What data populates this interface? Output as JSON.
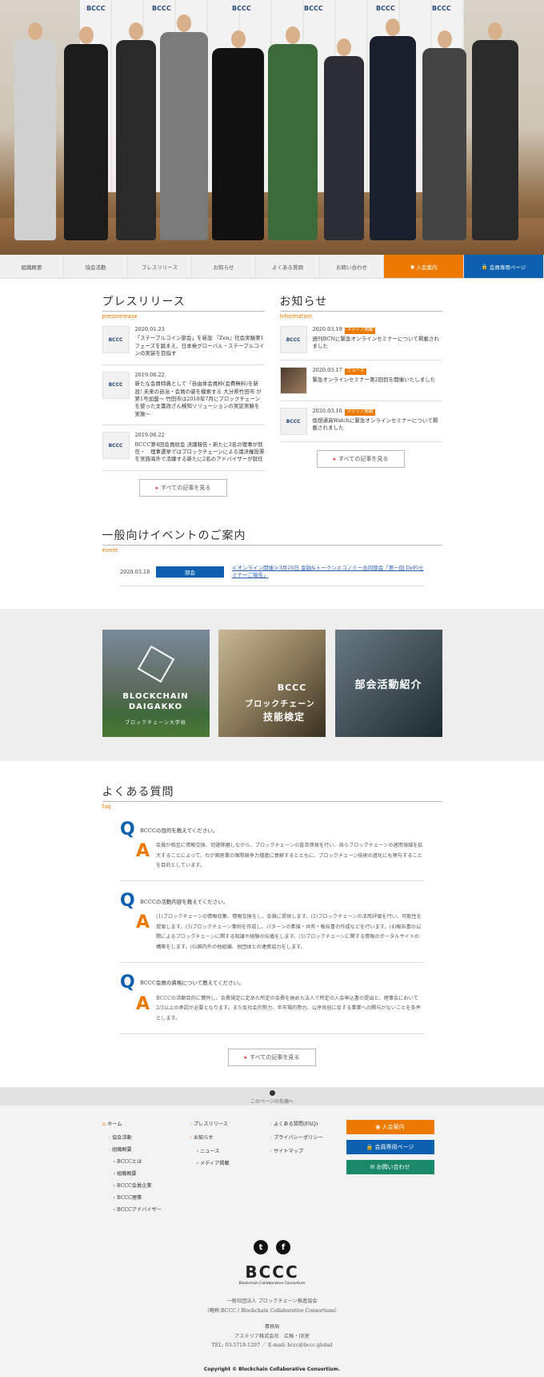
{
  "colors": {
    "accent_orange": "#ec7a00",
    "accent_blue": "#0d5fb0",
    "accent_green": "#1a8a66"
  },
  "hero": {
    "backdrop_logo": "BCCC"
  },
  "nav": {
    "items": [
      "組織概要",
      "協会活動",
      "プレスリリース",
      "お知らせ",
      "よくある質問",
      "お問い合わせ"
    ],
    "join": "入会案内",
    "members": "会員専用ページ"
  },
  "press": {
    "title": "プレスリリース",
    "sub": "pressrelease",
    "thumb_logo": "BCCC",
    "items": [
      {
        "date": "2020.01.23",
        "text": "「ステーブルコイン部会」を新設 『Zen』社会実験第1フェーズを踏まえ、日本発グローバル・ステーブルコインの実装を目指す"
      },
      {
        "date": "2019.08.22",
        "text": "新たな会員特典として「自由体会員枠(会費無料)を新設! 未来の自治・会員の姿を模索する 大分県竹田市 が第1号加盟〜 竹田市は2018年7月にブロックチェーンを使った文書改ざん検知ソリューションの実証実験を実施〜"
      },
      {
        "date": "2019.08.22",
        "text": "BCCC第4回会員総会 決議報告・新たに3名の理事が就任・　理事選挙ではブロックチェーンによる議決権投票を実施海外で活躍する新たに2名のアドバイザーが就任"
      }
    ],
    "more": "すべての記事を見る"
  },
  "info": {
    "title": "お知らせ",
    "sub": "Information",
    "thumb_logo": "BCCC",
    "items": [
      {
        "date": "2020.03.19",
        "tag": "メディア掲載",
        "text": "週刊BCNに緊急オンラインセミナーについて掲載されました"
      },
      {
        "date": "2020.03.17",
        "tag": "ニュース",
        "text": "緊急オンラインセミナー第2回目を開催いたしました"
      },
      {
        "date": "2020.03.10",
        "tag": "メディア掲載",
        "text": "仮想通貨Watchに緊急オンラインセミナーについて掲載されました"
      }
    ],
    "more": "すべての記事を見る"
  },
  "event": {
    "title": "一般向けイベントのご案内",
    "sub": "event",
    "items": [
      {
        "date": "2020.03.18",
        "category": "部会",
        "text": "≪オンライン開催≫3月26日 金融&トークンエコノミー合同部会「第一回 DeFiセミナーご報告」"
      }
    ]
  },
  "banners": {
    "b1_title": "BLOCKCHAIN",
    "b1_title2": "DAIGAKKO",
    "b1_sub": "ブロックチェーン大学校",
    "b2_logo": "BCCC",
    "b2_title": "ブロックチェーン",
    "b2_title2": "技能検定",
    "b3_title": "部会活動紹介"
  },
  "faq": {
    "title": "よくある質問",
    "sub": "faq",
    "items": [
      {
        "q": "BCCCの目的を教えてください。",
        "a": "会員が相互に情報交換、切磋琢磨しながら、ブロックチェーンの普及啓発を行い、自らブロックチェーンの適用領域を拡大することによって、わが国産業の国際競争力増進に貢献するとともに、ブロックチェーン技術の進化にも寄与することを目的としています。"
      },
      {
        "q": "BCCCの活動内容を教えてください。",
        "a": "(1)ブロックチェーンの情報収集、情報交換をし、会員に提供します。(2)ブロックチェーンの活用評価を行い、可能性を提案します。(3)ブロックチェーン事例を作成し、パターンの素描・共有・報告書の作成などを行います。(4)報告書の公開によるブロックチェーンに関する知識や経験の伝播をします。(5)ブロックチェーンに関する情報のポータルサイトの構築をします。(6)国内外の他組織、他団体との連携協力をします。"
      },
      {
        "q": "BCCC会員の資格について教えてください。",
        "a": "BCCCの活動目的に賛同し、会費規定に定めた所定の会費を納めた法人で所定の入会申込書の提出と、理事会において2/3以上の承認が必要となります。また反社会的勢力、半市場的勢力、公序良俗に反する事業への関与がないことを条件とします。"
      }
    ],
    "more": "すべての記事を見る"
  },
  "pagetop": "このページの先頭へ",
  "footer": {
    "col1": [
      "ホーム",
      "協会活動",
      "組織概要"
    ],
    "col1_sub": [
      "BCCCとは",
      "組織概要",
      "BCCC会員企業",
      "BCCC理事",
      "BCCCアドバイザー"
    ],
    "col2": [
      "プレスリリース",
      "お知らせ"
    ],
    "col2_sub": [
      "ニュース",
      "メディア掲載"
    ],
    "col3": [
      "よくある質問(FAQ)",
      "プライバシーポリシー",
      "サイトマップ"
    ],
    "btn_join": "入会案内",
    "btn_members": "会員専用ページ",
    "btn_contact": "お問い合わせ",
    "logo": "BCCC",
    "logo_small": "Blockchain Collaborative Consortium",
    "org1": "一般社団法人 ブロックチェーン推進協会",
    "org2": "（略称:BCCC / Blockchain Collaborative Consortium）",
    "office": "事務局",
    "office2": "アステリア株式会社　広報・IR室",
    "tel": "TEL: 03-5718-1297 ／ E-mail: bccc@bccc.global",
    "copyright": "Copyright © Blockchain Collaborative Consortium."
  }
}
